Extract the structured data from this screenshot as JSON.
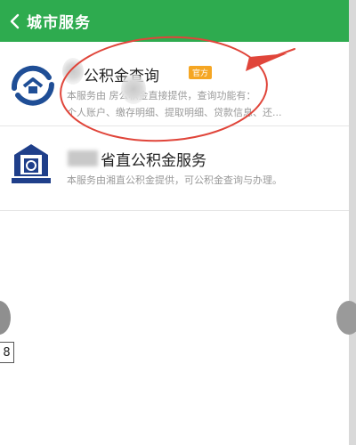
{
  "header": {
    "title": "城市服务"
  },
  "items": [
    {
      "title": "公积金查询",
      "badge": "官方",
      "desc_line1": "本服务由 房公积金直接提供，查询功能有：",
      "desc_line2": "个人账户、缴存明细、提取明细、贷款信息、还..."
    },
    {
      "title": "省直公积金服务",
      "desc_line1": "本服务由湘直公积金提供，可公积金查询与办理。"
    }
  ],
  "page_indicator": "8",
  "colors": {
    "header_bg": "#2eab4f",
    "badge_bg": "#f5a623",
    "annotation": "#e0453a"
  },
  "icons": {
    "back": "chevron-left-icon",
    "item1_logo": "housing-fund-logo-icon",
    "item2_logo": "provincial-fund-logo-icon"
  }
}
